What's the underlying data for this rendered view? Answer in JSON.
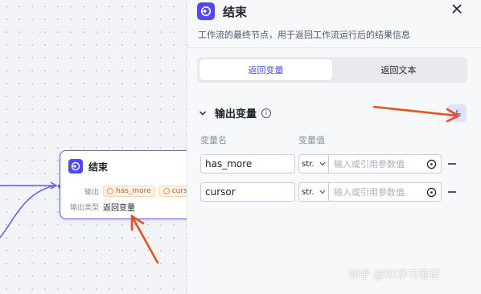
{
  "node": {
    "title": "结束",
    "output_label": "输出",
    "output_tags": [
      "has_more",
      "curso"
    ],
    "output_type_label": "输出类型",
    "output_type_value": "返回变量"
  },
  "panel": {
    "title": "结束",
    "description": "工作流的最终节点，用于返回工作流运行后的结果信息",
    "tabs": [
      {
        "label": "返回变量",
        "active": true
      },
      {
        "label": "返回文本",
        "active": false
      }
    ],
    "section_title": "输出变量",
    "columns": {
      "name": "变量名",
      "value": "变量值"
    },
    "variables": [
      {
        "name": "has_more",
        "type": "str.",
        "ref_placeholder": "输入或引用参数值"
      },
      {
        "name": "cursor",
        "type": "str.",
        "ref_placeholder": "输入或引用参数值"
      }
    ]
  },
  "watermark": "知乎 @KK学习笔记",
  "colors": {
    "accent": "#5147ff",
    "tab_active": "#3f51ff",
    "annotation": "#e8501f",
    "node_border": "#5b5fe8"
  }
}
